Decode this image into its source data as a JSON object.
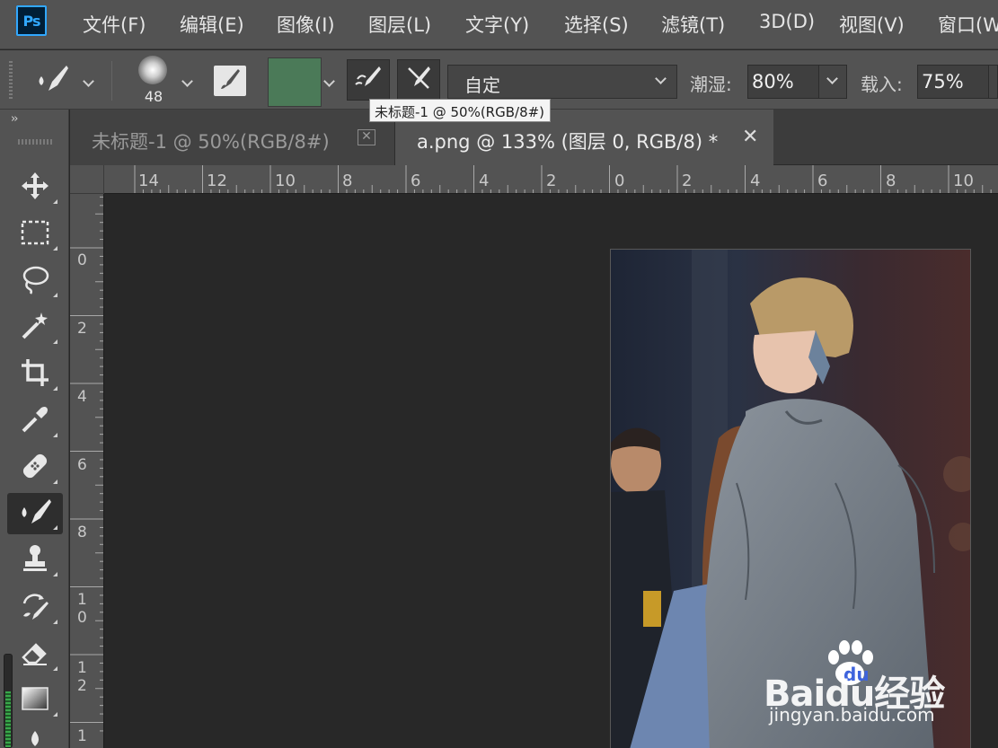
{
  "app": {
    "logo_text": "Ps"
  },
  "menu": {
    "items": [
      "文件(F)",
      "编辑(E)",
      "图像(I)",
      "图层(L)",
      "文字(Y)",
      "选择(S)",
      "滤镜(T)",
      "3D(D)",
      "视图(V)",
      "窗口(W)"
    ]
  },
  "options": {
    "brush_size": "48",
    "color_hex": "#4b7a58",
    "preset_value": "自定",
    "wet_label": "潮湿:",
    "wet_value": "80%",
    "load_label": "载入:",
    "load_value": "75%"
  },
  "tooltip": {
    "text": "未标题-1 @ 50%(RGB/8#)"
  },
  "tabs": [
    {
      "label": "未标题-1 @ 50%(RGB/8#)",
      "close": "✕",
      "active": false
    },
    {
      "label": "a.png @ 133% (图层 0, RGB/8) *",
      "close": "✕",
      "active": true
    }
  ],
  "ruler": {
    "horizontal_labels": [
      "14",
      "12",
      "10",
      "8",
      "6",
      "4",
      "2",
      "0",
      "2",
      "4",
      "6",
      "8",
      "10"
    ],
    "vertical_labels": [
      "0",
      "2",
      "4",
      "6",
      "8",
      "10",
      "12",
      "1"
    ]
  },
  "tools": [
    "move-tool-icon",
    "marquee-tool-icon",
    "lasso-tool-icon",
    "magic-wand-tool-icon",
    "crop-tool-icon",
    "eyedropper-tool-icon",
    "healing-brush-tool-icon",
    "mixer-brush-tool-icon",
    "clone-stamp-tool-icon",
    "history-brush-tool-icon",
    "eraser-tool-icon",
    "gradient-tool-icon"
  ],
  "watermark": {
    "brand": "Baidu经验",
    "url": "jingyan.baidu.com"
  }
}
